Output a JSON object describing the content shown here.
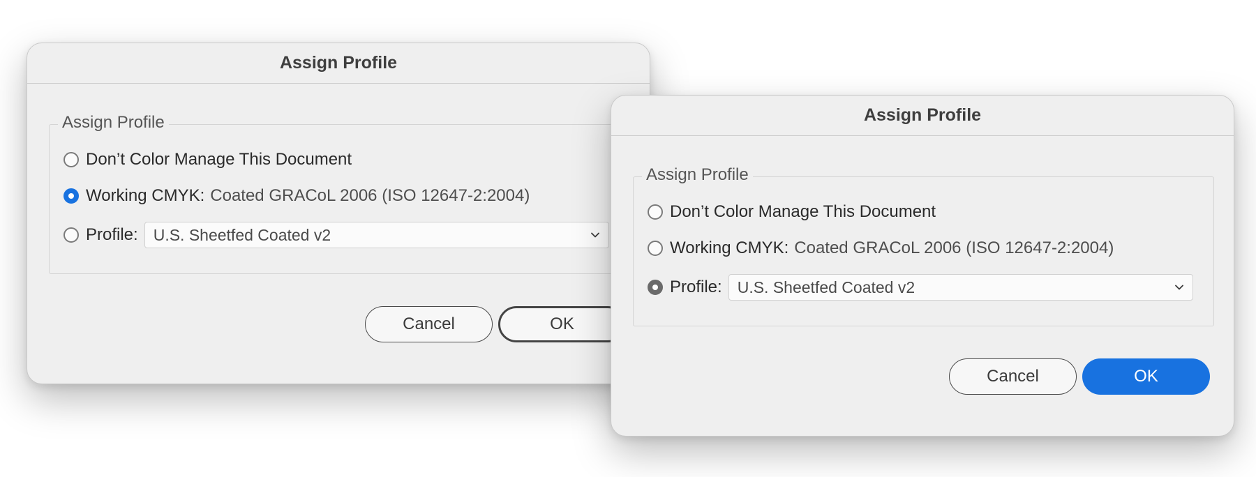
{
  "dialogs": [
    {
      "title": "Assign Profile",
      "group_label": "Assign Profile",
      "options": {
        "dont_manage": "Don’t Color Manage This Document",
        "working_label": "Working CMYK:",
        "working_value": "Coated GRACoL 2006 (ISO 12647-2:2004)",
        "profile_label": "Profile:",
        "profile_value": "U.S. Sheetfed Coated v2"
      },
      "selected": "working_cmyk",
      "buttons": {
        "cancel": "Cancel",
        "ok": "OK"
      }
    },
    {
      "title": "Assign Profile",
      "group_label": "Assign Profile",
      "options": {
        "dont_manage": "Don’t Color Manage This Document",
        "working_label": "Working CMYK:",
        "working_value": "Coated GRACoL 2006 (ISO 12647-2:2004)",
        "profile_label": "Profile:",
        "profile_value": "U.S. Sheetfed Coated v2"
      },
      "selected": "profile",
      "buttons": {
        "cancel": "Cancel",
        "ok": "OK"
      }
    }
  ],
  "colors": {
    "accent_blue": "#1872e0",
    "dialog_bg": "#efefef",
    "selected_gray": "#6a6a6a"
  },
  "icons": {
    "select_arrow": "chevron-down-icon"
  }
}
